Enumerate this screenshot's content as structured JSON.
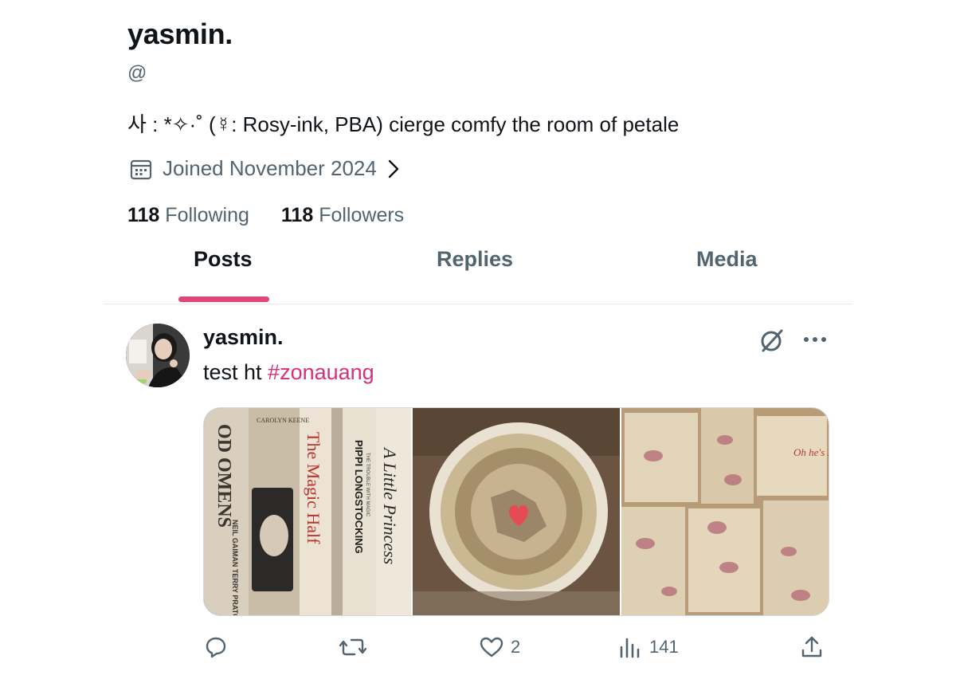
{
  "profile": {
    "display_name": "yasmin.",
    "handle": "@",
    "bio": "사 : *✧·˚ (☿: Rosy-ink, PBA) cierge comfy the room of petale",
    "joined": "Joined November 2024",
    "following_count": "118",
    "following_label": "Following",
    "followers_count": "118",
    "followers_label": "Followers"
  },
  "tabs": [
    {
      "label": "Posts",
      "active": true
    },
    {
      "label": "Replies",
      "active": false
    },
    {
      "label": "Media",
      "active": false
    }
  ],
  "post": {
    "author": "yasmin.",
    "text": "test ht ",
    "hashtag": "#zonauang",
    "book_spines": [
      "OD OMENS",
      "NEIL GAIMAN TERRY PRATCHETT",
      "CAROLYN KEENE",
      "The Magic Half",
      "PIPPI LONGSTOCKING",
      "THE TROUBLE WITH MAGIC",
      "A Little Princess"
    ],
    "note_text": "Oh he's Pink",
    "actions": {
      "reply_count": "",
      "repost_count": "",
      "like_count": "2",
      "views_count": "141"
    }
  },
  "icons": {
    "calendar": "calendar-icon",
    "chevron": "chevron-right-icon",
    "grok": "grok-icon",
    "more": "more-icon",
    "reply": "reply-icon",
    "repost": "repost-icon",
    "like": "heart-icon",
    "views": "views-icon",
    "share": "share-icon"
  },
  "colors": {
    "accent": "#e0457b",
    "hashtag": "#d6307a",
    "secondary_text": "#536471",
    "primary_text": "#0f1419"
  }
}
